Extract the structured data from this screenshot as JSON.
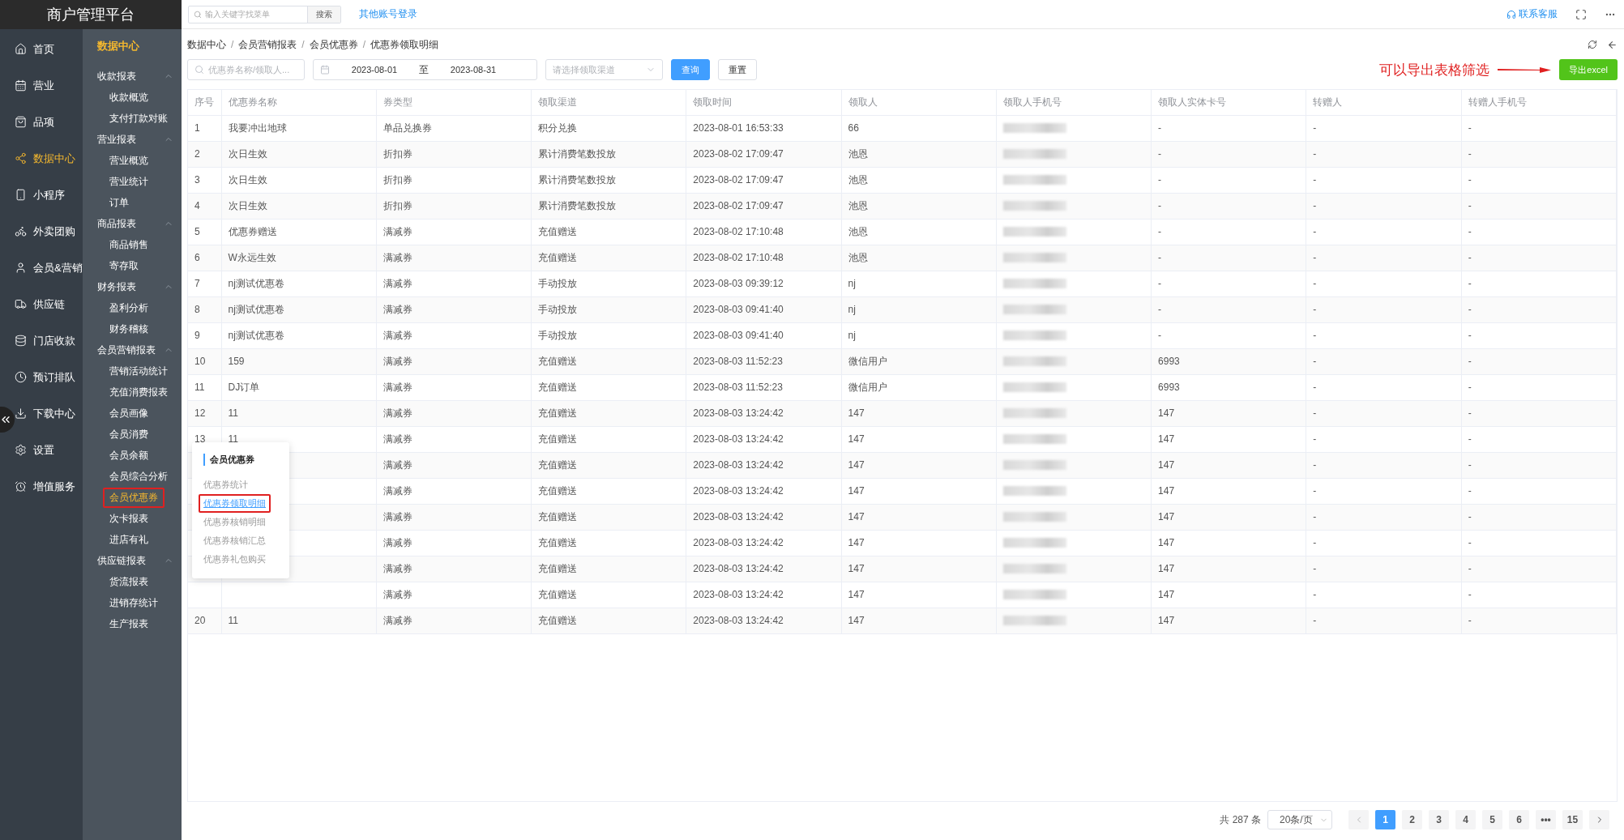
{
  "app_title": "商户管理平台",
  "nav": [
    {
      "label": "首页",
      "selected": false
    },
    {
      "label": "营业",
      "selected": false
    },
    {
      "label": "品项",
      "selected": false
    },
    {
      "label": "数据中心",
      "selected": true
    },
    {
      "label": "小程序",
      "selected": false
    },
    {
      "label": "外卖团购",
      "selected": false
    },
    {
      "label": "会员&营销",
      "selected": false
    },
    {
      "label": "供应链",
      "selected": false
    },
    {
      "label": "门店收款",
      "selected": false
    },
    {
      "label": "预订排队",
      "selected": false
    },
    {
      "label": "下载中心",
      "selected": false
    },
    {
      "label": "设置",
      "selected": false
    },
    {
      "label": "增值服务",
      "selected": false
    }
  ],
  "subnav": {
    "title": "数据中心",
    "groups": [
      {
        "label": "收款报表",
        "expanded": true,
        "items": [
          {
            "label": "收款概览",
            "selected": false,
            "annotated": false
          },
          {
            "label": "支付打款对账",
            "selected": false,
            "annotated": false
          }
        ]
      },
      {
        "label": "营业报表",
        "expanded": true,
        "items": [
          {
            "label": "营业概览",
            "selected": false,
            "annotated": false
          },
          {
            "label": "营业统计",
            "selected": false,
            "annotated": false
          },
          {
            "label": "订单",
            "selected": false,
            "annotated": false
          }
        ]
      },
      {
        "label": "商品报表",
        "expanded": true,
        "items": [
          {
            "label": "商品销售",
            "selected": false,
            "annotated": false
          },
          {
            "label": "寄存取",
            "selected": false,
            "annotated": false
          }
        ]
      },
      {
        "label": "财务报表",
        "expanded": true,
        "items": [
          {
            "label": "盈利分析",
            "selected": false,
            "annotated": false
          },
          {
            "label": "财务稽核",
            "selected": false,
            "annotated": false
          }
        ]
      },
      {
        "label": "会员营销报表",
        "expanded": true,
        "items": [
          {
            "label": "营销活动统计",
            "selected": false,
            "annotated": false
          },
          {
            "label": "充值消费报表",
            "selected": false,
            "annotated": false
          },
          {
            "label": "会员画像",
            "selected": false,
            "annotated": false
          },
          {
            "label": "会员消费",
            "selected": false,
            "annotated": false
          },
          {
            "label": "会员余额",
            "selected": false,
            "annotated": false
          },
          {
            "label": "会员综合分析",
            "selected": false,
            "annotated": false
          },
          {
            "label": "会员优惠券",
            "selected": true,
            "annotated": true
          },
          {
            "label": "次卡报表",
            "selected": false,
            "annotated": false
          },
          {
            "label": "进店有礼",
            "selected": false,
            "annotated": false
          }
        ]
      },
      {
        "label": "供应链报表",
        "expanded": true,
        "items": [
          {
            "label": "货流报表",
            "selected": false,
            "annotated": false
          },
          {
            "label": "进销存统计",
            "selected": false,
            "annotated": false
          },
          {
            "label": "生产报表",
            "selected": false,
            "annotated": false
          }
        ]
      }
    ]
  },
  "topbar": {
    "search_placeholder": "输入关键字找菜单",
    "search_button": "搜索",
    "link": "其他账号登录",
    "support": "联系客服"
  },
  "breadcrumb": {
    "separator": "/",
    "items": [
      "数据中心",
      "会员营销报表",
      "会员优惠券",
      "优惠券领取明细"
    ]
  },
  "filters": {
    "keyword_placeholder": "优惠券名称/领取人...",
    "date_from": "2023-08-01",
    "date_sep": "至",
    "date_to": "2023-08-31",
    "channel_placeholder": "请选择领取渠道",
    "query": "查询",
    "reset": "重置"
  },
  "annotation": "可以导出表格筛选",
  "export_button": "导出excel",
  "table": {
    "columns": [
      "序号",
      "优惠券名称",
      "券类型",
      "领取渠道",
      "领取时间",
      "领取人",
      "领取人手机号",
      "领取人实体卡号",
      "转赠人",
      "转赠人手机号"
    ],
    "rows": [
      {
        "index": "1",
        "name": "我要冲出地球",
        "type": "单品兑换券",
        "channel": "积分兑换",
        "time": "2023-08-01 16:53:33",
        "receiver": "66",
        "card": "-",
        "giver": "-",
        "giver_phone": "-"
      },
      {
        "index": "2",
        "name": "次日生效",
        "type": "折扣券",
        "channel": "累计消费笔数投放",
        "time": "2023-08-02 17:09:47",
        "receiver": "池恩",
        "card": "-",
        "giver": "-",
        "giver_phone": "-"
      },
      {
        "index": "3",
        "name": "次日生效",
        "type": "折扣券",
        "channel": "累计消费笔数投放",
        "time": "2023-08-02 17:09:47",
        "receiver": "池恩",
        "card": "-",
        "giver": "-",
        "giver_phone": "-"
      },
      {
        "index": "4",
        "name": "次日生效",
        "type": "折扣券",
        "channel": "累计消费笔数投放",
        "time": "2023-08-02 17:09:47",
        "receiver": "池恩",
        "card": "-",
        "giver": "-",
        "giver_phone": "-"
      },
      {
        "index": "5",
        "name": "优惠券赠送",
        "type": "满减券",
        "channel": "充值赠送",
        "time": "2023-08-02 17:10:48",
        "receiver": "池恩",
        "card": "-",
        "giver": "-",
        "giver_phone": "-"
      },
      {
        "index": "6",
        "name": "W永远生效",
        "type": "满减券",
        "channel": "充值赠送",
        "time": "2023-08-02 17:10:48",
        "receiver": "池恩",
        "card": "-",
        "giver": "-",
        "giver_phone": "-"
      },
      {
        "index": "7",
        "name": "nj测试优惠卷",
        "type": "满减券",
        "channel": "手动投放",
        "time": "2023-08-03 09:39:12",
        "receiver": "nj",
        "card": "-",
        "giver": "-",
        "giver_phone": "-"
      },
      {
        "index": "8",
        "name": "nj测试优惠卷",
        "type": "满减券",
        "channel": "手动投放",
        "time": "2023-08-03 09:41:40",
        "receiver": "nj",
        "card": "-",
        "giver": "-",
        "giver_phone": "-"
      },
      {
        "index": "9",
        "name": "nj测试优惠卷",
        "type": "满减券",
        "channel": "手动投放",
        "time": "2023-08-03 09:41:40",
        "receiver": "nj",
        "card": "-",
        "giver": "-",
        "giver_phone": "-"
      },
      {
        "index": "10",
        "name": "159",
        "type": "满减券",
        "channel": "充值赠送",
        "time": "2023-08-03 11:52:23",
        "receiver": "微信用户",
        "card": "6993",
        "giver": "-",
        "giver_phone": "-"
      },
      {
        "index": "11",
        "name": "DJ订单",
        "type": "满减券",
        "channel": "充值赠送",
        "time": "2023-08-03 11:52:23",
        "receiver": "微信用户",
        "card": "6993",
        "giver": "-",
        "giver_phone": "-"
      },
      {
        "index": "12",
        "name": "11",
        "type": "满减券",
        "channel": "充值赠送",
        "time": "2023-08-03 13:24:42",
        "receiver": "147",
        "card": "147",
        "giver": "-",
        "giver_phone": "-"
      },
      {
        "index": "13",
        "name": "11",
        "type": "满减券",
        "channel": "充值赠送",
        "time": "2023-08-03 13:24:42",
        "receiver": "147",
        "card": "147",
        "giver": "-",
        "giver_phone": "-"
      },
      {
        "type": "满减券",
        "channel": "充值赠送",
        "time": "2023-08-03 13:24:42",
        "receiver": "147",
        "card": "147",
        "giver": "-",
        "giver_phone": "-"
      },
      {
        "type": "满减券",
        "channel": "充值赠送",
        "time": "2023-08-03 13:24:42",
        "receiver": "147",
        "card": "147",
        "giver": "-",
        "giver_phone": "-"
      },
      {
        "type": "满减券",
        "channel": "充值赠送",
        "time": "2023-08-03 13:24:42",
        "receiver": "147",
        "card": "147",
        "giver": "-",
        "giver_phone": "-"
      },
      {
        "type": "满减券",
        "channel": "充值赠送",
        "time": "2023-08-03 13:24:42",
        "receiver": "147",
        "card": "147",
        "giver": "-",
        "giver_phone": "-"
      },
      {
        "type": "满减券",
        "channel": "充值赠送",
        "time": "2023-08-03 13:24:42",
        "receiver": "147",
        "card": "147",
        "giver": "-",
        "giver_phone": "-"
      },
      {
        "type": "满减券",
        "channel": "充值赠送",
        "time": "2023-08-03 13:24:42",
        "receiver": "147",
        "card": "147",
        "giver": "-",
        "giver_phone": "-"
      },
      {
        "index": "20",
        "name": "11",
        "type": "满减券",
        "channel": "充值赠送",
        "time": "2023-08-03 13:24:42",
        "receiver": "147",
        "card": "147",
        "giver": "-",
        "giver_phone": "-"
      }
    ]
  },
  "flyout": {
    "title": "会员优惠券",
    "items": [
      {
        "label": "优惠券统计",
        "selected": false,
        "annotated": false
      },
      {
        "label": "优惠券领取明细",
        "selected": true,
        "annotated": true
      },
      {
        "label": "优惠券核销明细",
        "selected": false,
        "annotated": false
      },
      {
        "label": "优惠券核销汇总",
        "selected": false,
        "annotated": false
      },
      {
        "label": "优惠券礼包购买",
        "selected": false,
        "annotated": false
      }
    ]
  },
  "pagination": {
    "total": "共 287 条",
    "page_size": "20条/页",
    "pages": [
      {
        "label": "1",
        "selected": true
      },
      {
        "label": "2",
        "selected": false
      },
      {
        "label": "3",
        "selected": false
      },
      {
        "label": "4",
        "selected": false
      },
      {
        "label": "5",
        "selected": false
      },
      {
        "label": "6",
        "selected": false
      },
      {
        "label": "•••",
        "selected": false
      },
      {
        "label": "15",
        "selected": false
      }
    ]
  }
}
